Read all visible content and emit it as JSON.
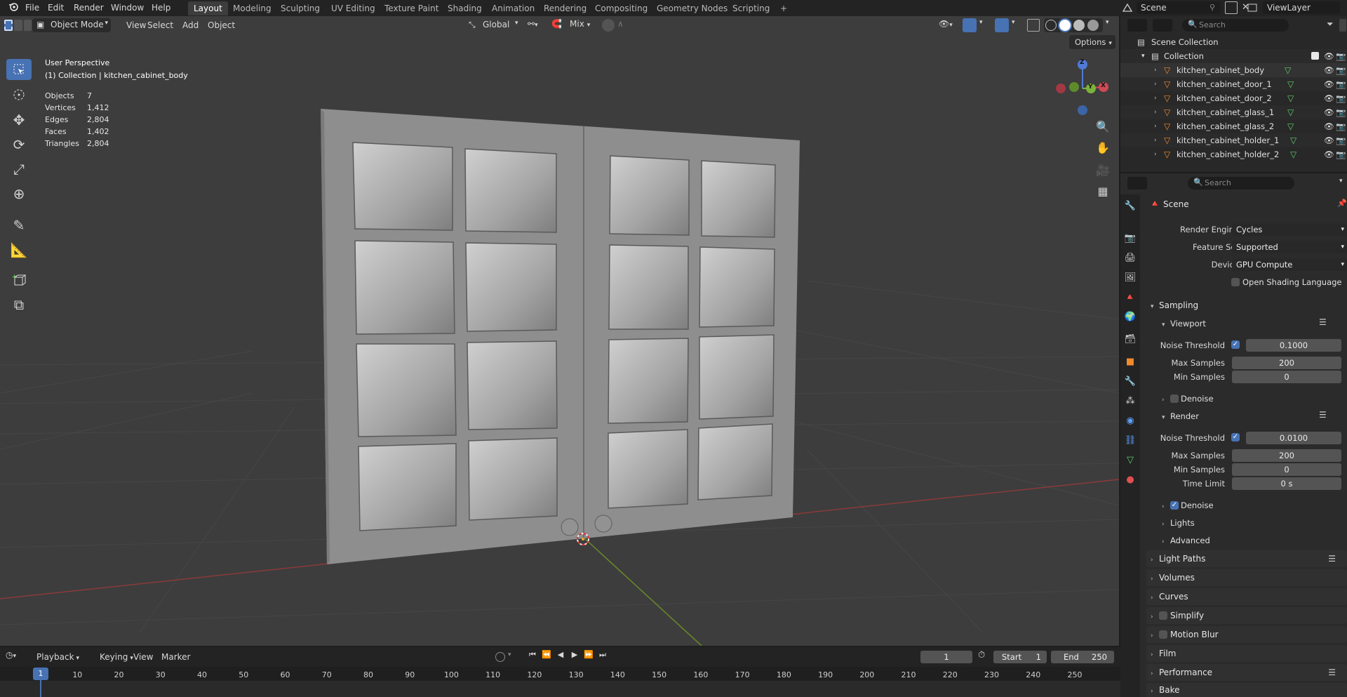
{
  "topbar": {
    "menus": [
      "File",
      "Edit",
      "Render",
      "Window",
      "Help"
    ],
    "workspaces": [
      "Layout",
      "Modeling",
      "Sculpting",
      "UV Editing",
      "Texture Paint",
      "Shading",
      "Animation",
      "Rendering",
      "Compositing",
      "Geometry Nodes",
      "Scripting"
    ],
    "active_workspace": "Layout",
    "add_tab": "+",
    "scene": "Scene",
    "view_layer": "ViewLayer"
  },
  "viewport_header": {
    "mode": "Object Mode",
    "menus": [
      "View",
      "Select",
      "Add",
      "Object"
    ],
    "orientation": "Global",
    "snap_mode": "Mix",
    "options": "Options"
  },
  "overlay": {
    "perspective": "User Perspective",
    "collection": "(1) Collection | kitchen_cabinet_body",
    "stats": [
      {
        "label": "Objects",
        "value": "7"
      },
      {
        "label": "Vertices",
        "value": "1,412"
      },
      {
        "label": "Edges",
        "value": "2,804"
      },
      {
        "label": "Faces",
        "value": "1,402"
      },
      {
        "label": "Triangles",
        "value": "2,804"
      }
    ]
  },
  "gizmo": {
    "x": "X",
    "y": "Y",
    "z": "Z"
  },
  "outliner": {
    "search_placeholder": "Search",
    "scene_collection": "Scene Collection",
    "collection": "Collection",
    "objects": [
      "kitchen_cabinet_body",
      "kitchen_cabinet_door_1",
      "kitchen_cabinet_door_2",
      "kitchen_cabinet_glass_1",
      "kitchen_cabinet_glass_2",
      "kitchen_cabinet_holder_1",
      "kitchen_cabinet_holder_2"
    ]
  },
  "properties": {
    "search_placeholder": "Search",
    "context": "Scene",
    "render_engine_label": "Render Engine",
    "render_engine": "Cycles",
    "feature_set_label": "Feature Set",
    "feature_set": "Supported",
    "device_label": "Device",
    "device": "GPU Compute",
    "osl": "Open Shading Language",
    "sampling": "Sampling",
    "viewport": "Viewport",
    "noise_threshold_label": "Noise Threshold",
    "viewport_noise": "0.1000",
    "max_samples_label": "Max Samples",
    "viewport_max": "200",
    "min_samples_label": "Min Samples",
    "viewport_min": "0",
    "denoise": "Denoise",
    "render": "Render",
    "render_noise": "0.0100",
    "render_max": "200",
    "render_min": "0",
    "time_limit_label": "Time Limit",
    "time_limit": "0 s",
    "lights": "Lights",
    "advanced": "Advanced",
    "sections": [
      "Light Paths",
      "Volumes",
      "Curves",
      "Simplify",
      "Motion Blur",
      "Film",
      "Performance",
      "Bake"
    ]
  },
  "timeline": {
    "menus": [
      "Playback",
      "Keying",
      "View",
      "Marker"
    ],
    "current_frame": "1",
    "start_label": "Start",
    "start": "1",
    "end_label": "End",
    "end": "250",
    "ticks": [
      "1",
      "10",
      "20",
      "30",
      "40",
      "50",
      "60",
      "70",
      "80",
      "90",
      "100",
      "110",
      "120",
      "130",
      "140",
      "150",
      "160",
      "170",
      "180",
      "190",
      "200",
      "210",
      "220",
      "230",
      "240",
      "250"
    ]
  }
}
